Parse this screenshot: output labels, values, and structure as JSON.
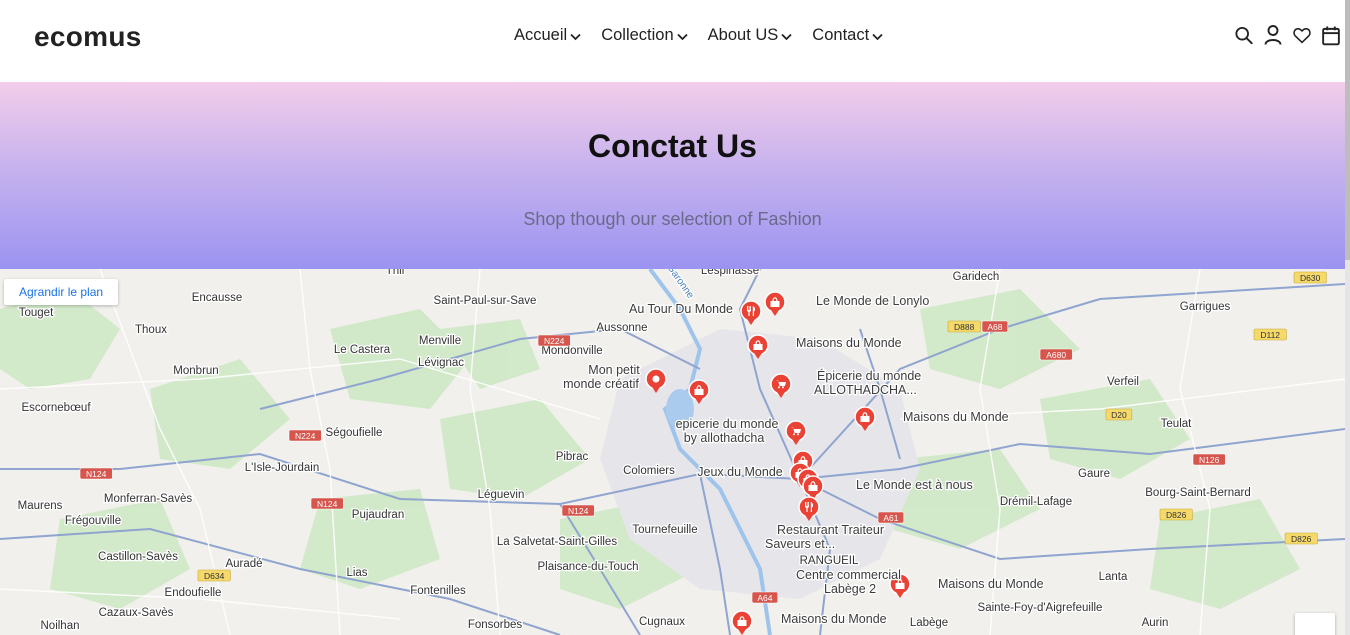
{
  "brand": {
    "logo": "ecomus"
  },
  "nav": {
    "items": [
      {
        "label": "Accueil"
      },
      {
        "label": "Collection"
      },
      {
        "label": "About US"
      },
      {
        "label": "Contact"
      }
    ]
  },
  "header_icons": [
    "search-icon",
    "user-icon",
    "heart-icon",
    "calendar-icon"
  ],
  "hero": {
    "title": "Conctat Us",
    "subtitle": "Shop though our selection of Fashion"
  },
  "map": {
    "enlarge_label": "Agrandir le plan",
    "places": [
      {
        "name": "Thil"
      },
      {
        "name": "Lespinasse"
      },
      {
        "name": "Garidech"
      },
      {
        "name": "Encausse"
      },
      {
        "name": "Saint-Paul-sur-Save"
      },
      {
        "name": "Au Tour Du Monde"
      },
      {
        "name": "Le Monde de Lonylo"
      },
      {
        "name": "Touget"
      },
      {
        "name": "Aussonne"
      },
      {
        "name": "Garrigues"
      },
      {
        "name": "Thoux"
      },
      {
        "name": "Menville"
      },
      {
        "name": "Maisons du Monde"
      },
      {
        "name": "Le Castera"
      },
      {
        "name": "Mondonville"
      },
      {
        "name": "Lévignac"
      },
      {
        "name": "Monbrun"
      },
      {
        "name": "Mon petit"
      },
      {
        "name": "monde créatif"
      },
      {
        "name": "Épicerie du monde"
      },
      {
        "name": "ALLOTHADCHA..."
      },
      {
        "name": "Verfeil"
      },
      {
        "name": "Escornebœuf"
      },
      {
        "name": "Maisons du Monde"
      },
      {
        "name": "epicerie du monde"
      },
      {
        "name": "by allothadcha"
      },
      {
        "name": "Ségoufielle"
      },
      {
        "name": "Teulat"
      },
      {
        "name": "Pibrac"
      },
      {
        "name": "Colomiers"
      },
      {
        "name": "Jeux du Monde"
      },
      {
        "name": "L'Isle-Jourdain"
      },
      {
        "name": "Le Monde est à nous"
      },
      {
        "name": "Gaure"
      },
      {
        "name": "Léguevin"
      },
      {
        "name": "Monferran-Savès"
      },
      {
        "name": "Bourg-Saint-Bernard"
      },
      {
        "name": "Maurens"
      },
      {
        "name": "Drémil-Lafage"
      },
      {
        "name": "Pujaudran"
      },
      {
        "name": "Frégouville"
      },
      {
        "name": "Tournefeuille"
      },
      {
        "name": "Restaurant Traiteur"
      },
      {
        "name": "Saveurs et..."
      },
      {
        "name": "La Salvetat-Saint-Gilles"
      },
      {
        "name": "RANGUEIL"
      },
      {
        "name": "Castillon-Savès"
      },
      {
        "name": "Plaisance-du-Touch"
      },
      {
        "name": "Auradé"
      },
      {
        "name": "Lias"
      },
      {
        "name": "Centre commercial"
      },
      {
        "name": "Labège 2"
      },
      {
        "name": "Maisons du Monde"
      },
      {
        "name": "Lanta"
      },
      {
        "name": "Endoufielle"
      },
      {
        "name": "Fontenilles"
      },
      {
        "name": "Cazaux-Savès"
      },
      {
        "name": "Sainte-Foy-d'Aigrefeuille"
      },
      {
        "name": "Noilhan"
      },
      {
        "name": "Fonsorbes"
      },
      {
        "name": "Cugnaux"
      },
      {
        "name": "Maisons du Monde"
      },
      {
        "name": "Labège"
      },
      {
        "name": "Aurin"
      },
      {
        "name": "Garonne"
      }
    ],
    "roads": [
      "D630",
      "D112",
      "D888",
      "A68",
      "N224",
      "A680",
      "D20",
      "N224",
      "N126",
      "N124",
      "N124",
      "N124",
      "A61",
      "D826",
      "D826",
      "D634",
      "A64"
    ]
  },
  "colors": {
    "hero_top": "#f3cdea",
    "hero_bottom": "#9b93f1",
    "marker": "#ea4335",
    "link": "#1a73e8"
  }
}
